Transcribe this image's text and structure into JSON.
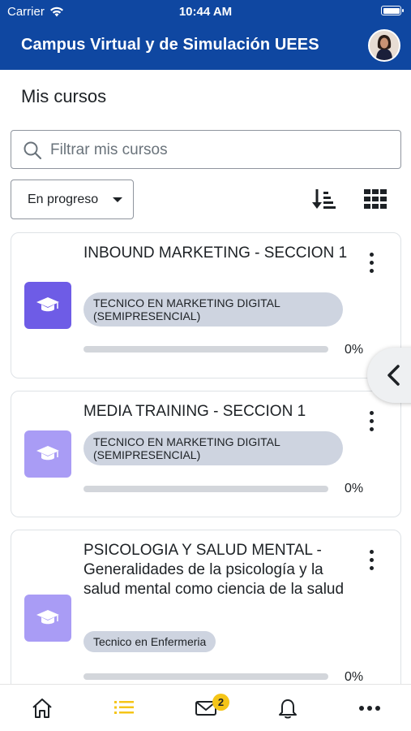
{
  "status_bar": {
    "carrier": "Carrier",
    "time": "10:44 AM"
  },
  "header": {
    "title": "Campus Virtual y de Simulación UEES"
  },
  "page": {
    "title": "Mis cursos"
  },
  "search": {
    "placeholder": "Filtrar mis cursos",
    "value": ""
  },
  "filter": {
    "selected": "En progreso"
  },
  "courses": [
    {
      "name": "INBOUND MARKETING - SECCION 1",
      "category": "TECNICO EN MARKETING DIGITAL (SEMIPRESENCIAL)",
      "progress": "0%",
      "progress_fraction": 0,
      "image_color": "#6e5ce6"
    },
    {
      "name": "MEDIA TRAINING - SECCION 1",
      "category": "TECNICO EN MARKETING DIGITAL (SEMIPRESENCIAL)",
      "progress": "0%",
      "progress_fraction": 0,
      "image_color": "#a99cf5"
    },
    {
      "name": "PSICOLOGIA Y SALUD MENTAL - Generalidades de la psicología y la salud mental como ciencia de la salud",
      "category": "Tecnico en Enfermeria",
      "progress": "0%",
      "progress_fraction": 0,
      "image_color": "#a99cf5"
    }
  ],
  "tabbar": {
    "active_color": "#f5c518",
    "messages_badge": "2",
    "items": [
      "home-icon",
      "list-icon",
      "mail-icon",
      "bell-icon",
      "more-icon"
    ]
  },
  "colors": {
    "brand": "#0f47a1"
  }
}
